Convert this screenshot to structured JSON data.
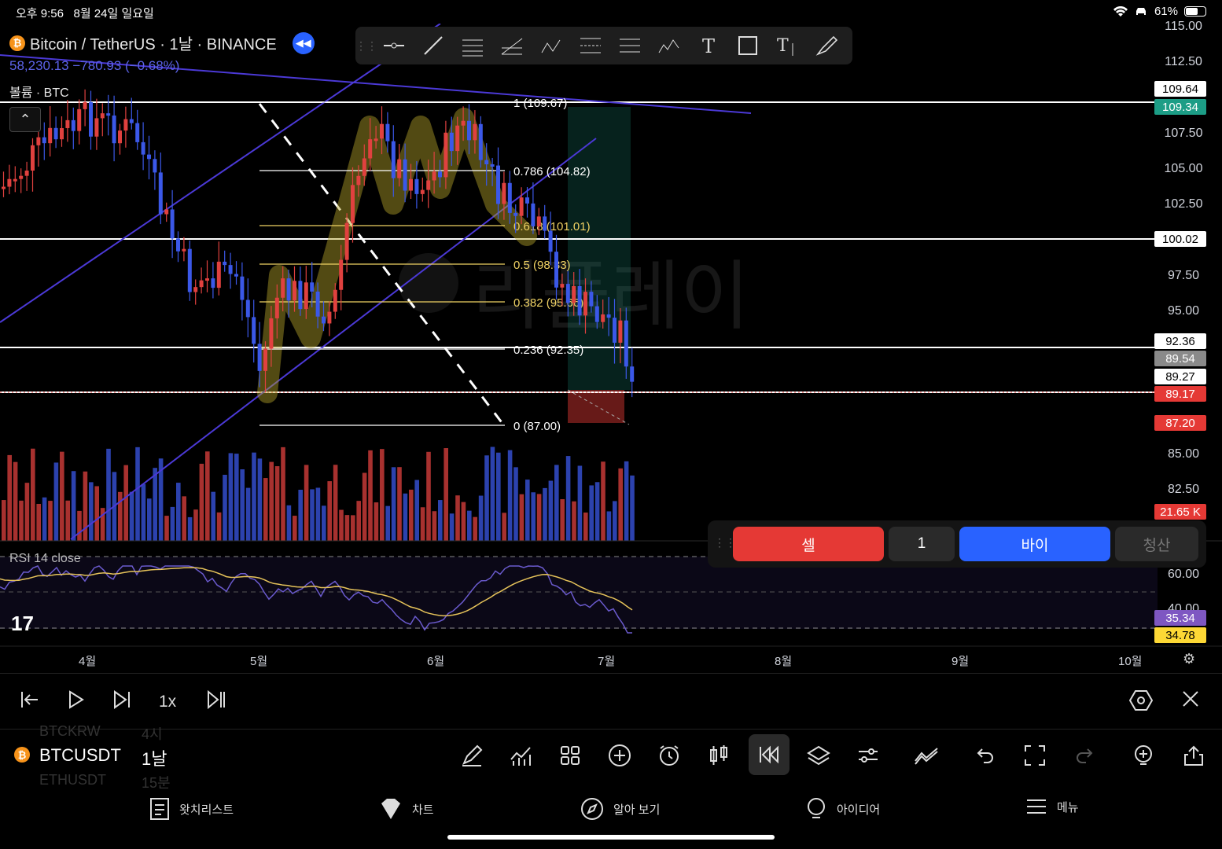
{
  "status": {
    "time": "오후 9:56",
    "date": "8월 24일 일요일",
    "battery": "61%"
  },
  "legend": {
    "title": "Bitcoin / TetherUS · 1날 · BINANCE",
    "ohlc": "58,230.13  −780.93 (−0.68%)",
    "volume_label": "볼륨 · BTC"
  },
  "watermark": "리플레이",
  "price_axis": [
    "115.00",
    "112.50",
    "107.50",
    "105.00",
    "102.50",
    "97.50",
    "95.00",
    "85.00",
    "82.50",
    "60.00",
    "40.00"
  ],
  "price_labels": [
    {
      "text": "109.64",
      "bg": "#ffffff",
      "fg": "#000000"
    },
    {
      "text": "109.34",
      "bg": "#1c9d86",
      "fg": "#ffffff"
    },
    {
      "text": "100.02",
      "bg": "#ffffff",
      "fg": "#000000"
    },
    {
      "text": "92.36",
      "bg": "#ffffff",
      "fg": "#000000"
    },
    {
      "text": "89.54",
      "bg": "#8a8a8a",
      "fg": "#ffffff"
    },
    {
      "text": "89.27",
      "bg": "#ffffff",
      "fg": "#000000"
    },
    {
      "text": "89.17",
      "bg": "#e53935",
      "fg": "#ffffff"
    },
    {
      "text": "87.20",
      "bg": "#e53935",
      "fg": "#ffffff"
    },
    {
      "text": "21.65 K",
      "bg": "#e53935",
      "fg": "#ffffff"
    },
    {
      "text": "35.34",
      "bg": "#7e57c2",
      "fg": "#ffffff"
    },
    {
      "text": "34.78",
      "bg": "#fdd835",
      "fg": "#000000"
    }
  ],
  "fib": [
    {
      "label": "1 (109.67)",
      "color": "#ffffff"
    },
    {
      "label": "0.786 (104.82)",
      "color": "#ffffff"
    },
    {
      "label": "0.618 (101.01)",
      "color": "#f0d264"
    },
    {
      "label": "0.5 (98.33)",
      "color": "#f0d264"
    },
    {
      "label": "0.382 (95.66)",
      "color": "#f0d264"
    },
    {
      "label": "0.236 (92.35)",
      "color": "#ffffff"
    },
    {
      "label": "0 (87.00)",
      "color": "#ffffff"
    }
  ],
  "months": [
    "4월",
    "5월",
    "6월",
    "7월",
    "8월",
    "9월",
    "10월"
  ],
  "rsi_label": "RSI 14 close",
  "trade": {
    "sell": "셀",
    "qty": "1",
    "buy": "바이",
    "close": "청산"
  },
  "replay": {
    "speed": "1x"
  },
  "symbol": {
    "ghost_top": "BTCKRW",
    "ghost_top_tf": "4시",
    "name": "BTCUSDT",
    "tf": "1날",
    "ghost_bottom": "ETHUSDT",
    "ghost_bottom_tf": "15분"
  },
  "nav": [
    {
      "label": "왓치리스트",
      "icon": "watchlist-icon"
    },
    {
      "label": "차트",
      "icon": "chart-icon"
    },
    {
      "label": "알아 보기",
      "icon": "explore-icon"
    },
    {
      "label": "아이디어",
      "icon": "ideas-icon"
    },
    {
      "label": "메뉴",
      "icon": "menu-icon"
    }
  ],
  "colors": {
    "up": "#e0413f",
    "down": "#3b58e8",
    "channel": "#4b39d6",
    "accent": "#2962ff"
  },
  "chart_data": {
    "type": "candlestick",
    "series": [
      {
        "name": "BTCUSDT",
        "values": []
      }
    ],
    "rsi_values": [],
    "note_ranges": {
      "y_range": [
        80,
        115
      ]
    }
  }
}
